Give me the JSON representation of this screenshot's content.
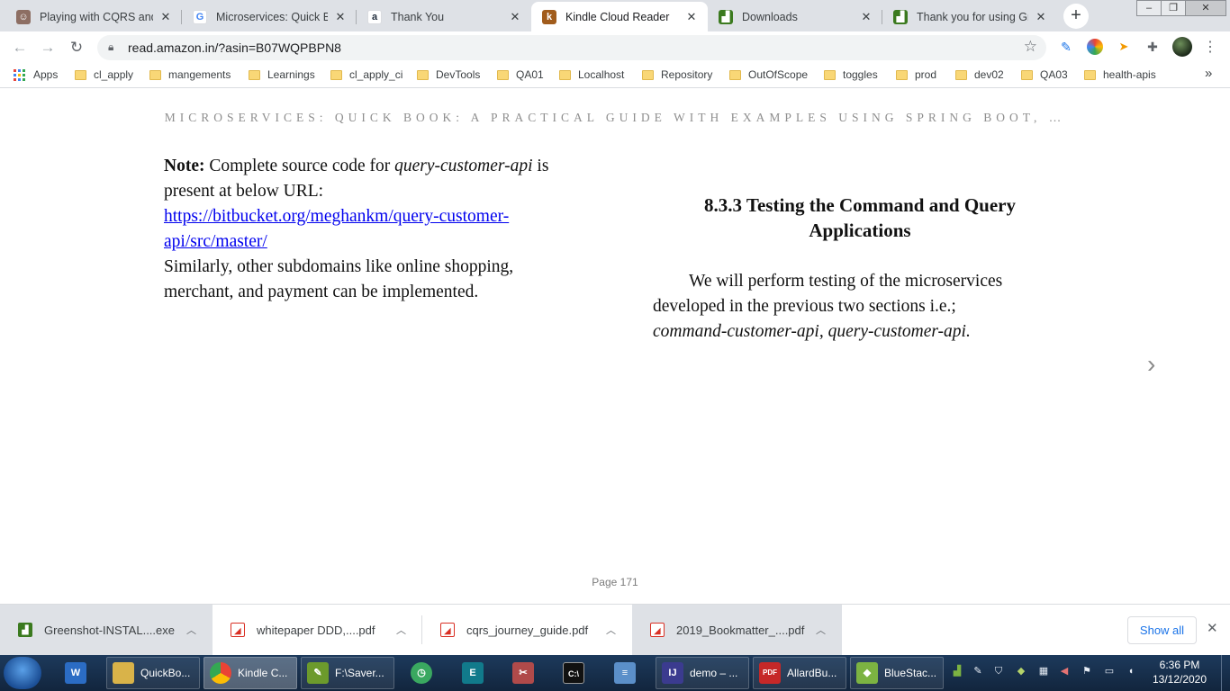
{
  "browser": {
    "tabs": [
      {
        "title": "Playing with CQRS and E",
        "favicon": "person-avatar-icon",
        "color": "#8d6e63"
      },
      {
        "title": "Microservices: Quick Boo",
        "favicon": "google-icon",
        "color": "#4285f4"
      },
      {
        "title": "Thank You",
        "favicon": "amazon-icon",
        "color": "#232f3e"
      },
      {
        "title": "Kindle Cloud Reader",
        "favicon": "kindle-icon",
        "color": "#a15c1c"
      },
      {
        "title": "Downloads",
        "favicon": "greenshot-icon",
        "color": "#3b7a1f"
      },
      {
        "title": "Thank you for using Gre",
        "favicon": "greenshot-icon",
        "color": "#3b7a1f"
      }
    ],
    "new_tab": "+",
    "window_controls": {
      "minimize": "–",
      "maximize": "❐",
      "close": "✕"
    },
    "url": "read.amazon.in/?asin=B07WQPBPN8",
    "bookmarks": [
      {
        "label": "Apps",
        "type": "apps"
      },
      {
        "label": "cl_apply",
        "type": "folder"
      },
      {
        "label": "mangements",
        "type": "folder"
      },
      {
        "label": "Learnings",
        "type": "folder"
      },
      {
        "label": "cl_apply_ci",
        "type": "folder"
      },
      {
        "label": "DevTools",
        "type": "folder"
      },
      {
        "label": "QA01",
        "type": "folder"
      },
      {
        "label": "Localhost",
        "type": "folder"
      },
      {
        "label": "Repository",
        "type": "folder"
      },
      {
        "label": "OutOfScope",
        "type": "folder"
      },
      {
        "label": "toggles",
        "type": "folder"
      },
      {
        "label": "prod",
        "type": "folder"
      },
      {
        "label": "dev02",
        "type": "folder"
      },
      {
        "label": "QA03",
        "type": "folder"
      },
      {
        "label": "health-apis",
        "type": "folder"
      }
    ],
    "bookmarks_overflow": "»"
  },
  "reader": {
    "book_title": "MICROSERVICES: QUICK BOOK: A PRACTICAL GUIDE WITH EXAMPLES USING SPRING BOOT, …",
    "left": {
      "note_label": "Note:",
      "note_text": " Complete source code for ",
      "note_italic": "query-customer-api",
      "note_text2": " is present at below URL:",
      "link": "https://bitbucket.org/meghankm/query-customer-api/src/master/",
      "para2": "Similarly, other subdomains like online shopping, merchant, and payment can be implemented."
    },
    "right": {
      "heading": "8.3.3 Testing the Command and Query Applications",
      "para": "We will perform testing of the microservices developed in the previous two sections i.e.;",
      "para_italic": "command-customer-api, query-customer-api."
    },
    "next_page": "›",
    "page_label": "Page 171"
  },
  "downloads": {
    "items": [
      {
        "name": "Greenshot-INSTAL....exe",
        "icon": "greenshot-icon",
        "color": "#3b7a1f"
      },
      {
        "name": "whitepaper DDD,....pdf",
        "icon": "pdf-icon",
        "color": "#d93025"
      },
      {
        "name": "cqrs_journey_guide.pdf",
        "icon": "pdf-icon",
        "color": "#d93025"
      },
      {
        "name": "2019_Bookmatter_....pdf",
        "icon": "pdf-icon",
        "color": "#d93025"
      }
    ],
    "show_all": "Show all",
    "close": "✕"
  },
  "taskbar": {
    "items": [
      {
        "label": "",
        "icon": "w-app-icon",
        "color": "#2b6cc4"
      },
      {
        "label": "QuickBo...",
        "icon": "folder-icon",
        "color": "#d9b349"
      },
      {
        "label": "Kindle C...",
        "icon": "chrome-icon",
        "color": "#4285f4"
      },
      {
        "label": "F:\\Saver...",
        "icon": "notepad-plus-icon",
        "color": "#6c9a2c"
      },
      {
        "label": "",
        "icon": "timer-icon",
        "color": "#3aa860"
      },
      {
        "label": "",
        "icon": "editor-e-icon",
        "color": "#117a8b"
      },
      {
        "label": "",
        "icon": "snipping-icon",
        "color": "#b04a4a"
      },
      {
        "label": "",
        "icon": "cmd-icon",
        "color": "#111111"
      },
      {
        "label": "",
        "icon": "notepad-icon",
        "color": "#5b8fc9"
      },
      {
        "label": "demo – ...",
        "icon": "intellij-icon",
        "color": "#3b3b8f"
      },
      {
        "label": "AllardBu...",
        "icon": "pdf-reader-icon",
        "color": "#c62828"
      },
      {
        "label": "BlueStac...",
        "icon": "bluestacks-icon",
        "color": "#7cb342"
      }
    ],
    "time": "6:36 PM",
    "date": "13/12/2020"
  }
}
